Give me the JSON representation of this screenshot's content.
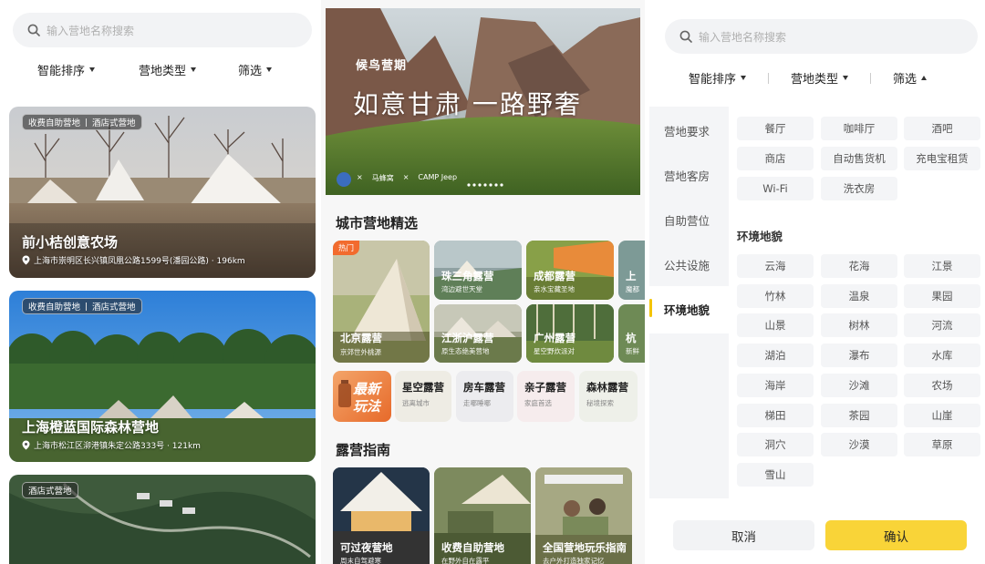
{
  "left": {
    "search_placeholder": "输入营地名称搜索",
    "sort": [
      "智能排序",
      "营地类型",
      "筛选"
    ],
    "cards": [
      {
        "tags": [
          "收费自助营地",
          "酒店式营地"
        ],
        "name": "前小桔创意农场",
        "address": "上海市崇明区长兴镇凤凰公路1599号(潘园公路) · 196km"
      },
      {
        "tags": [
          "收费自助营地",
          "酒店式营地"
        ],
        "name": "上海橙蓝国际森林营地",
        "address": "上海市松江区泖港镇朱定公路333号 · 121km"
      },
      {
        "tags": [
          "酒店式营地"
        ],
        "name": "",
        "address": ""
      }
    ]
  },
  "middle": {
    "banner": {
      "brand": "候鸟营期",
      "slogan": "如意甘肃 一路野奢",
      "partner1": "马蜂窝",
      "partner2": "CAMP Jeep"
    },
    "city_section_title": "城市营地精选",
    "hot_badge": "热门",
    "cities": [
      {
        "name": "北京露营",
        "sub": "京郊世外桃源"
      },
      {
        "name": "珠三角露营",
        "sub": "湾边避世天堂"
      },
      {
        "name": "成都露营",
        "sub": "亲水宝藏圣地"
      },
      {
        "name": "上",
        "sub": "魔都"
      },
      {
        "name": "江浙沪露营",
        "sub": "原生态绝美营地"
      },
      {
        "name": "广州露营",
        "sub": "星空野炊派对"
      },
      {
        "name": "杭",
        "sub": "新鲜"
      }
    ],
    "play": {
      "badge_line1": "最新",
      "badge_line2": "玩法"
    },
    "chips": [
      {
        "name": "星空露营",
        "sub": "逃离城市"
      },
      {
        "name": "房车露营",
        "sub": "走哪睡哪"
      },
      {
        "name": "亲子露营",
        "sub": "家庭首选"
      },
      {
        "name": "森林露营",
        "sub": "秘境探索"
      }
    ],
    "guide_section_title": "露营指南",
    "guides": [
      {
        "name": "可过夜营地",
        "sub": "周末自驾避寒"
      },
      {
        "name": "收费自助营地",
        "sub": "在野外自在露平"
      },
      {
        "name": "全国营地玩乐指南",
        "sub": "去户外打造独家记忆"
      }
    ]
  },
  "right": {
    "search_placeholder": "输入营地名称搜索",
    "sort": [
      "智能排序",
      "营地类型",
      "筛选"
    ],
    "side_tabs": [
      "营地要求",
      "营地客房",
      "自助营位",
      "公共设施",
      "环境地貌"
    ],
    "active_tab": "环境地貌",
    "facility_options": [
      "餐厅",
      "咖啡厅",
      "酒吧",
      "商店",
      "自动售货机",
      "充电宝租赁",
      "Wi-Fi",
      "洗衣房"
    ],
    "terrain_title": "环境地貌",
    "terrain_options": [
      "云海",
      "花海",
      "江景",
      "竹林",
      "温泉",
      "果园",
      "山景",
      "树林",
      "河流",
      "湖泊",
      "瀑布",
      "水库",
      "海岸",
      "沙滩",
      "农场",
      "梯田",
      "茶园",
      "山崖",
      "洞穴",
      "沙漠",
      "草原",
      "雪山"
    ],
    "cancel": "取消",
    "confirm": "确认",
    "colors": {
      "confirm_bg": "#f9d438",
      "accent_bar": "#f4c400"
    }
  }
}
